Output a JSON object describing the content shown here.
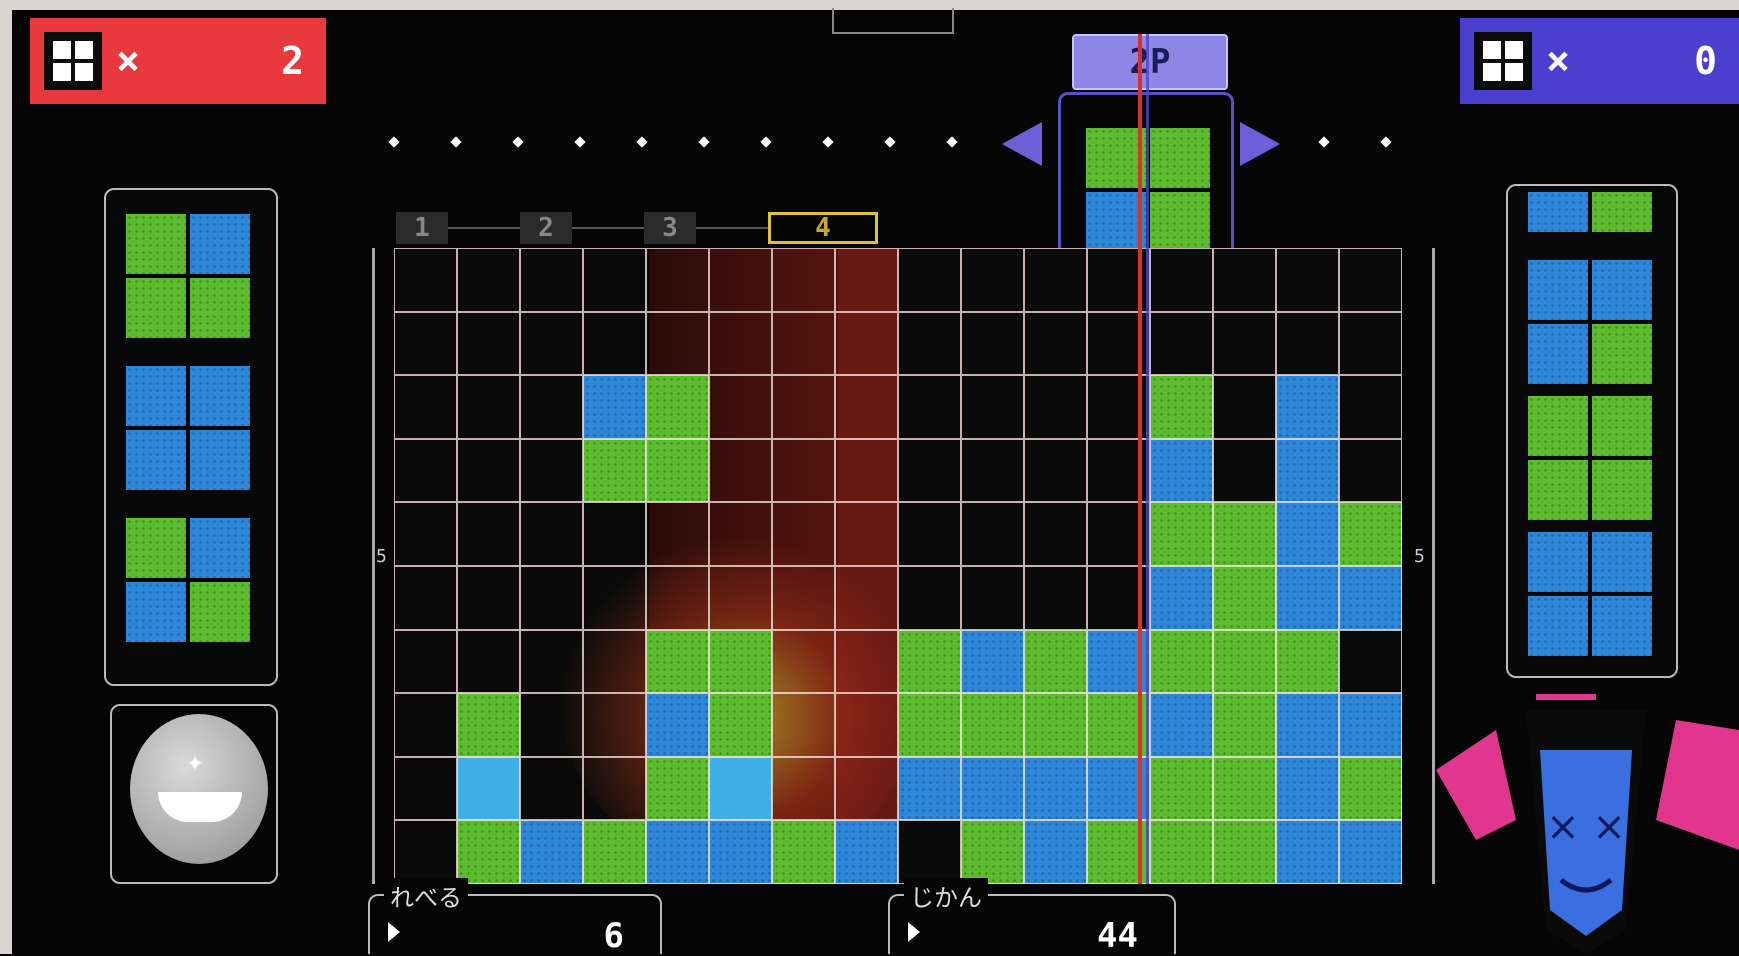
{
  "p1": {
    "blocks_label": "×",
    "blocks_count": "2",
    "color": "#e8393f"
  },
  "p2": {
    "blocks_label": "×",
    "blocks_count": "0",
    "color": "#4b3fd0",
    "tag": "2P"
  },
  "timeline": {
    "measures": [
      "1",
      "2",
      "3",
      "4"
    ],
    "side_marker": "5"
  },
  "level": {
    "label": "れべる",
    "value": "6"
  },
  "time": {
    "label": "じかん",
    "value": "44"
  },
  "board": {
    "rows": [
      "................",
      "................",
      "...bg.......g.b.",
      "...gg.......b.b.",
      "............ggbg",
      "............bgbb",
      "....gg..gbgbggg.",
      ".g..bg..ggggbgbb",
      ".l..gl..bbbbggbg",
      ".gbgbbgb.gbgggbb"
    ]
  },
  "queue_p1": [
    [
      "g",
      "b",
      "g",
      "g"
    ],
    [
      "b",
      "b",
      "b",
      "b"
    ],
    [
      "g",
      "b",
      "b",
      "g"
    ]
  ],
  "queue_p2": [
    [
      "b",
      "g"
    ],
    [
      "b",
      "b",
      "b",
      "g"
    ],
    [
      "g",
      "g",
      "g",
      "g"
    ],
    [
      "b",
      "b",
      "b",
      "b"
    ]
  ],
  "falling": [
    "g",
    "g",
    "b",
    "g"
  ],
  "icons": [
    "block-icon",
    "medal-icon",
    "avatar-face-icon"
  ]
}
